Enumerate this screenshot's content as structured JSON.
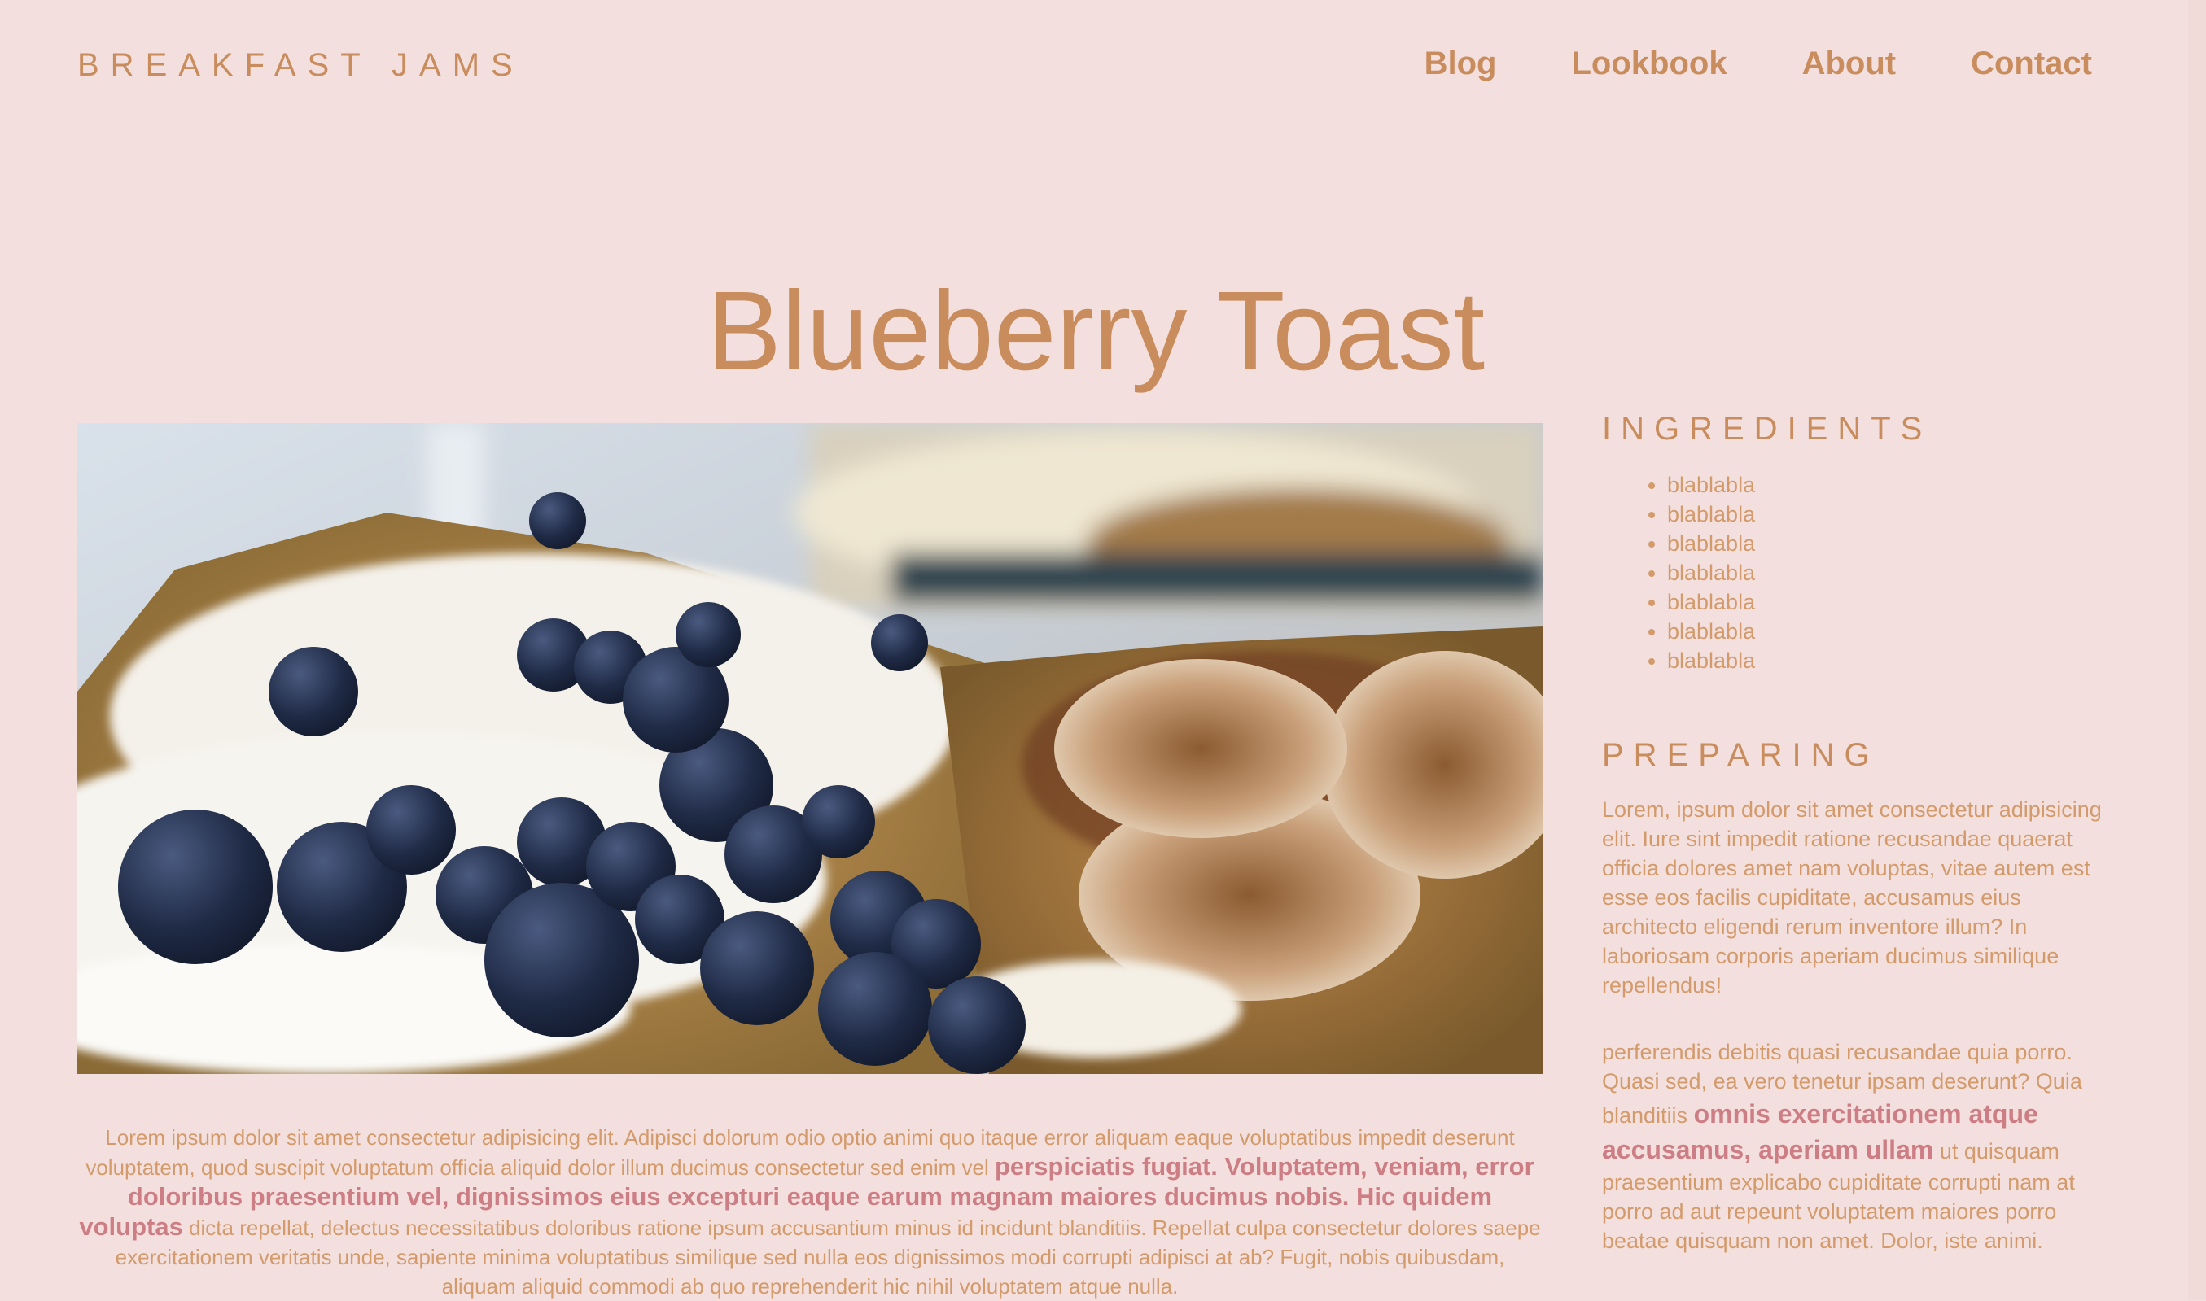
{
  "header": {
    "brand": "BREAKFAST JAMS",
    "nav": [
      "Blog",
      "Lookbook",
      "About",
      "Contact"
    ]
  },
  "page_title": "Blueberry Toast",
  "main": {
    "intro_text": "Lorem ipsum dolor sit amet consectetur adipisicing elit. Adipisci dolorum odio optio animi quo itaque error aliquam eaque voluptatibus impedit deserunt voluptatem, quod suscipit voluptatum officia aliquid dolor illum ducimus consectetur sed enim vel ",
    "intro_strong": "perspiciatis fugiat. Voluptatem, veniam, error doloribus praesentium vel, dignissimos eius excepturi eaque earum magnam maiores ducimus nobis. Hic quidem voluptas",
    "intro_tail": " dicta repellat, delectus necessitatibus doloribus ratione ipsum accusantium minus id incidunt blanditiis. Repellat culpa consectetur dolores saepe exercitationem veritatis unde, sapiente minima voluptatibus similique sed nulla eos dignissimos modi corrupti adipisci at ab? Fugit, nobis quibusdam, aliquam aliquid commodi ab quo reprehenderit hic nihil voluptatem atque nulla."
  },
  "sidebar": {
    "ingredients_heading": "INGREDIENTS",
    "ingredients": [
      "blablabla",
      "blablabla",
      "blablabla",
      "blablabla",
      "blablabla",
      "blablabla",
      "blablabla"
    ],
    "preparing_heading": "PREPARING",
    "preparing_p1": "Lorem, ipsum dolor sit amet consectetur adipisicing elit. Iure sint impedit ratione recusandae quaerat officia dolores amet nam voluptas, vitae autem est esse eos facilis cupiditate, accusamus eius architecto eligendi rerum inventore illum? In laboriosam corporis aperiam ducimus similique repellendus!",
    "preparing_p2_lead": "perferendis debitis quasi recusandae quia porro. Quasi sed, ea vero tenetur ipsam deserunt? Quia blanditiis ",
    "preparing_p2_strong": "omnis exercitationem atque accusamus, aperiam ullam",
    "preparing_p2_tail": " ut quisquam praesentium explicabo cupiditate corrupti nam at porro ad aut repeunt voluptatem maiores porro beatae quisquam non amet. Dolor, iste animi."
  },
  "colors": {
    "background": "#f3e0de",
    "accent": "#c98c5d",
    "highlight": "#cd7e85"
  }
}
